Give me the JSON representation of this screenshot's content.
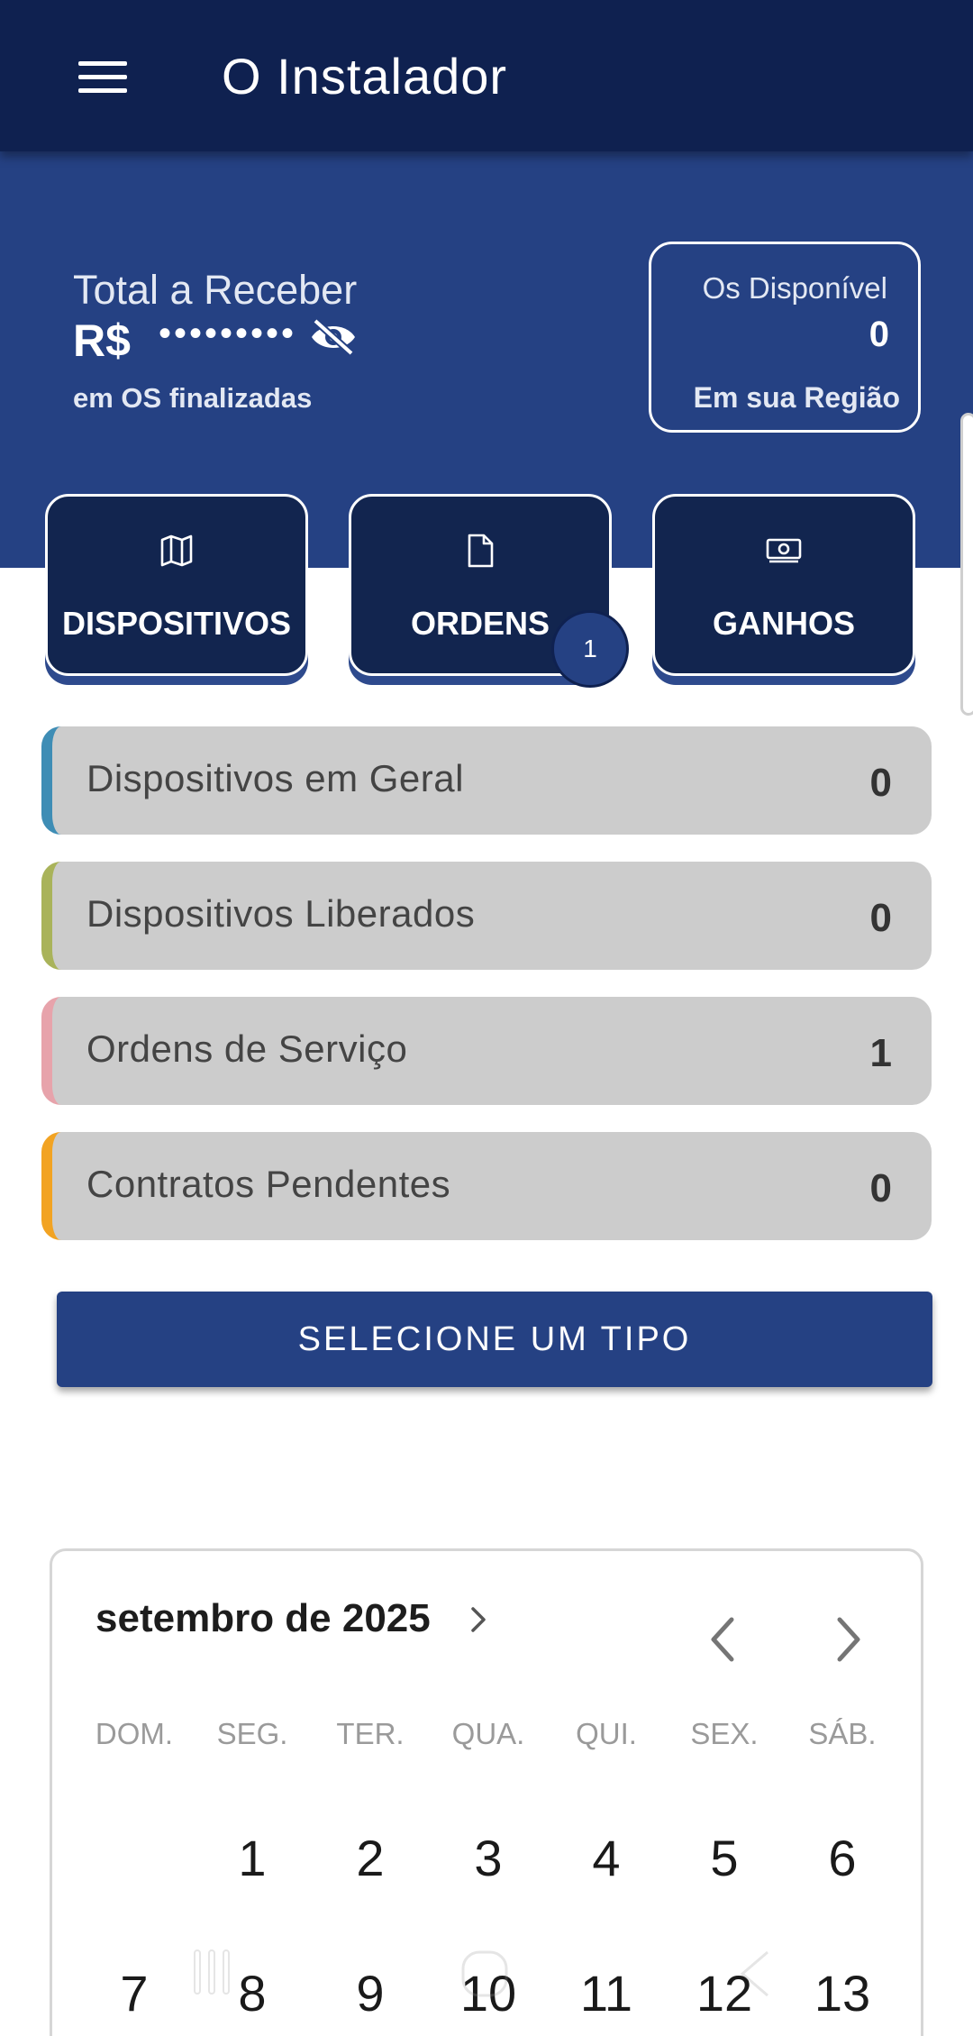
{
  "appbar": {
    "title": "O Instalador",
    "menu_icon": "menu-icon"
  },
  "summary": {
    "total_label": "Total a Receber",
    "currency": "R$",
    "masked_value": "•••••••••",
    "visibility_icon": "eye-off-icon",
    "subtitle": "em OS finalizadas"
  },
  "os_card": {
    "label": "Os Disponível",
    "count": "0",
    "subtitle": "Em sua Região"
  },
  "tiles": [
    {
      "label": "DISPOSITIVOS",
      "icon": "map-icon"
    },
    {
      "label": "ORDENS",
      "icon": "document-icon",
      "badge": "1"
    },
    {
      "label": "GANHOS",
      "icon": "money-icon"
    }
  ],
  "stats": [
    {
      "label": "Dispositivos em Geral",
      "value": "0",
      "color": "#3e8db5"
    },
    {
      "label": "Dispositivos Liberados",
      "value": "0",
      "color": "#a9b35a"
    },
    {
      "label": "Ordens de Serviço",
      "value": "1",
      "color": "#e7a3ab"
    },
    {
      "label": "Contratos Pendentes",
      "value": "0",
      "color": "#f2a322"
    }
  ],
  "select_button": {
    "label": "SELECIONE UM TIPO"
  },
  "calendar": {
    "month_label": "setembro de 2025",
    "weekdays": [
      "DOM.",
      "SEG.",
      "TER.",
      "QUA.",
      "QUI.",
      "SEX.",
      "SÁB."
    ],
    "week1": [
      "",
      "1",
      "2",
      "3",
      "4",
      "5",
      "6"
    ],
    "week2": [
      "7",
      "8",
      "9",
      "10",
      "11",
      "12",
      "13"
    ]
  },
  "colors": {
    "appbar": "#0f2150",
    "hero": "#254183",
    "tile": "#12254f",
    "button": "#254183"
  }
}
